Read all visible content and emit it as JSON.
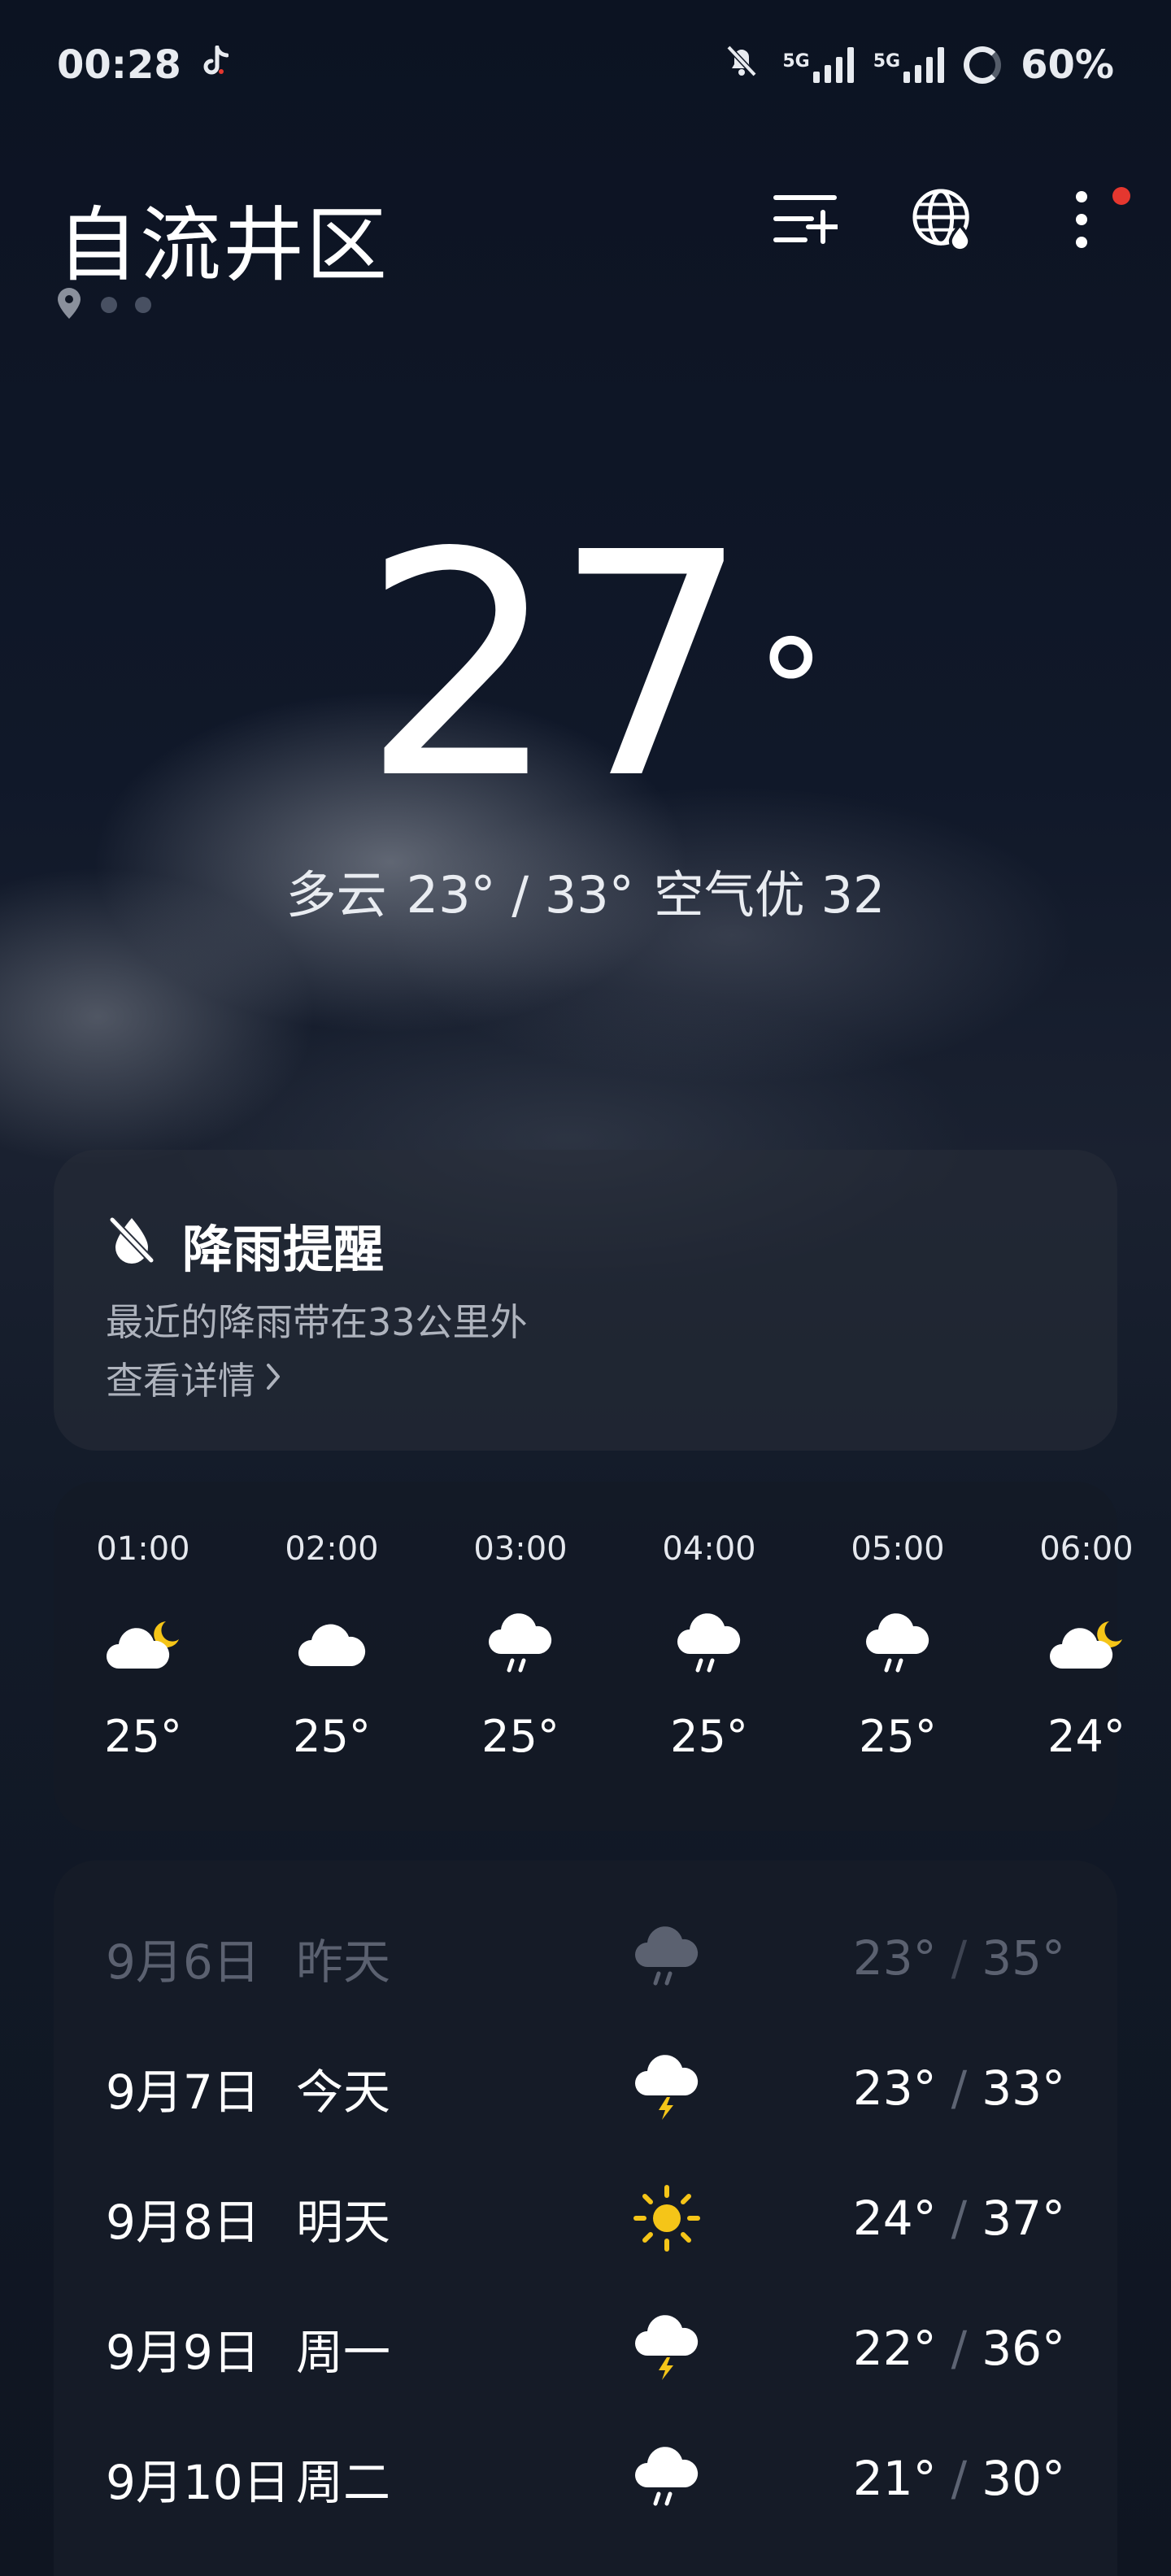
{
  "status_bar": {
    "time": "00:28",
    "network_1": "5G",
    "network_2": "5G",
    "battery": "60%"
  },
  "header": {
    "city": "自流井区",
    "icons": [
      "add-city-icon",
      "globe-rain-icon",
      "more-menu-icon"
    ]
  },
  "current": {
    "temp": "27",
    "deg": "°",
    "condition": "多云",
    "range": "23° / 33°",
    "aqi": "空气优 32"
  },
  "rain_alert": {
    "title": "降雨提醒",
    "desc": "最近的降雨带在33公里外",
    "link": "查看详情"
  },
  "hourly": [
    {
      "time": "01:00",
      "icon": "partly-cloudy-night-icon",
      "temp": "25°"
    },
    {
      "time": "02:00",
      "icon": "cloud-icon",
      "temp": "25°"
    },
    {
      "time": "03:00",
      "icon": "rain-icon",
      "temp": "25°"
    },
    {
      "time": "04:00",
      "icon": "rain-icon",
      "temp": "25°"
    },
    {
      "time": "05:00",
      "icon": "rain-icon",
      "temp": "25°"
    },
    {
      "time": "06:00",
      "icon": "partly-cloudy-night-icon",
      "temp": "24°"
    }
  ],
  "daily": [
    {
      "date": "9月6日",
      "rel": "昨天",
      "icon": "rain-icon",
      "low": "23°",
      "high": "35°"
    },
    {
      "date": "9月7日",
      "rel": "今天",
      "icon": "thunderstorm-icon",
      "low": "23°",
      "high": "33°"
    },
    {
      "date": "9月8日",
      "rel": "明天",
      "icon": "sun-icon",
      "low": "24°",
      "high": "37°"
    },
    {
      "date": "9月9日",
      "rel": "周一",
      "icon": "thunderstorm-icon",
      "low": "22°",
      "high": "36°"
    },
    {
      "date": "9月10日",
      "rel": "周二",
      "icon": "rain-icon",
      "low": "21°",
      "high": "30°"
    }
  ],
  "colors": {
    "background": "#0f1624",
    "accent_sun": "#f5c518",
    "notification_dot": "#e5372f"
  }
}
